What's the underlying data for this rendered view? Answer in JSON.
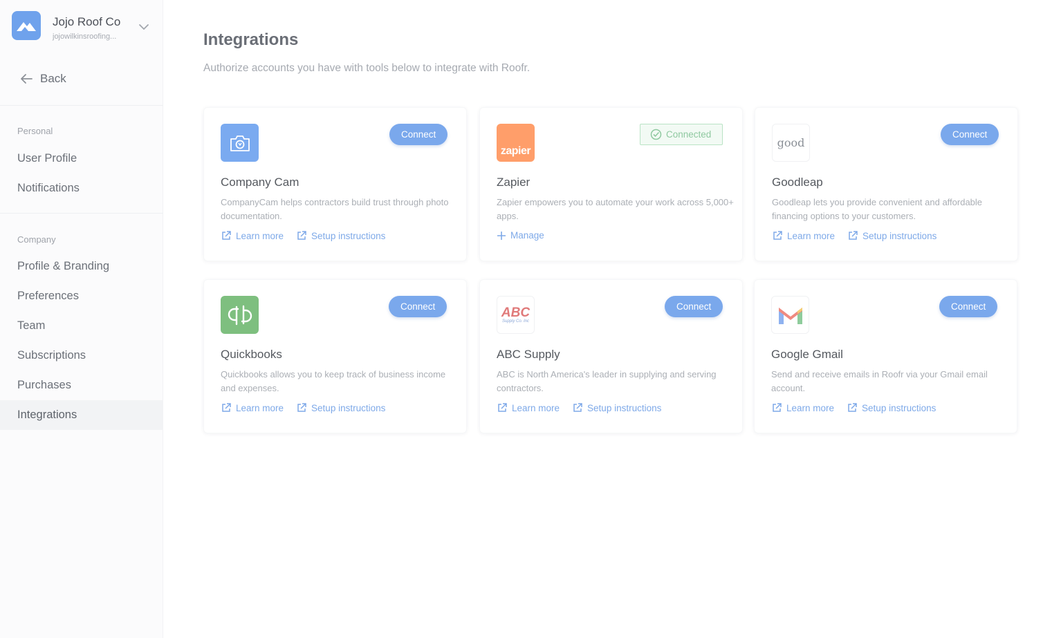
{
  "sidebar": {
    "org_name": "Jojo Roof Co",
    "org_email": "jojowilkinsroofing...",
    "back_label": "Back",
    "personal_title": "Personal",
    "personal_items": [
      "User Profile",
      "Notifications"
    ],
    "company_title": "Company",
    "company_items": [
      "Profile & Branding",
      "Preferences",
      "Team",
      "Subscriptions",
      "Purchases",
      "Integrations"
    ],
    "active_item": "Integrations"
  },
  "main": {
    "title": "Integrations",
    "subtitle": "Authorize accounts you have with tools below to integrate with Roofr."
  },
  "cards": [
    {
      "name": "Company Cam",
      "description": "CompanyCam helps contractors build trust through photo documentation.",
      "button": "Connect",
      "link1": "Learn more",
      "link2": "Setup instructions",
      "logo_color": "#7aaaf0"
    },
    {
      "name": "Zapier",
      "description": "Zapier empowers you to automate your work across 5,000+ apps.",
      "status": "Connected",
      "manage": "Manage",
      "logo_text": "zapier",
      "logo_color": "#ff9e6a"
    },
    {
      "name": "Goodleap",
      "description": "Goodleap lets you provide convenient and affordable financing options to your customers.",
      "button": "Connect",
      "link1": "Learn more",
      "link2": "Setup instructions",
      "logo_text": "good"
    },
    {
      "name": "Quickbooks",
      "description": "Quickbooks allows you to keep track of business income and expenses.",
      "button": "Connect",
      "link1": "Learn more",
      "link2": "Setup instructions",
      "logo_color": "#7ebf7f"
    },
    {
      "name": "ABC Supply",
      "description": "ABC is North America's leader in supplying and serving contractors.",
      "button": "Connect",
      "link1": "Learn more",
      "link2": "Setup instructions",
      "logo_text": "ABC",
      "logo_subtext": "Supply Co. Inc"
    },
    {
      "name": "Google Gmail",
      "description": "Send and receive emails in Roofr via your Gmail email account.",
      "button": "Connect",
      "link1": "Learn more",
      "link2": "Setup instructions"
    }
  ],
  "colors": {
    "accent": "#7aa8ec",
    "link": "#7ea9e8",
    "connected_border": "#b9e3c5",
    "connected_text": "#8fc9a0"
  }
}
